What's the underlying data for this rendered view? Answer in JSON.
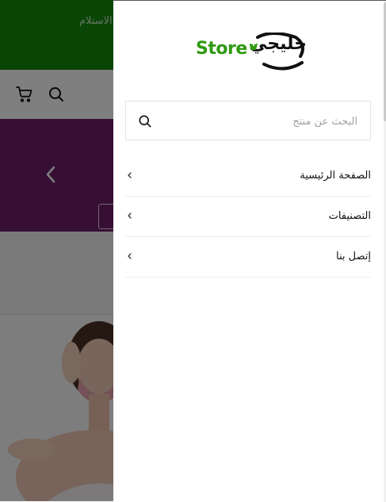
{
  "topbar": {
    "text": "الاستلام"
  },
  "drawer": {
    "logo": {
      "latin": "Store",
      "arabic": "خليجي"
    },
    "search": {
      "placeholder": "البحث عن منتج"
    },
    "menu": [
      {
        "label": "الصفحة الرئيسية"
      },
      {
        "label": "التصنيفات"
      },
      {
        "label": "إتصل بنا"
      }
    ]
  },
  "colors": {
    "brand_green": "#138a0b",
    "logo_green": "#2f9a13",
    "banner_purple": "#6e1f6a"
  }
}
